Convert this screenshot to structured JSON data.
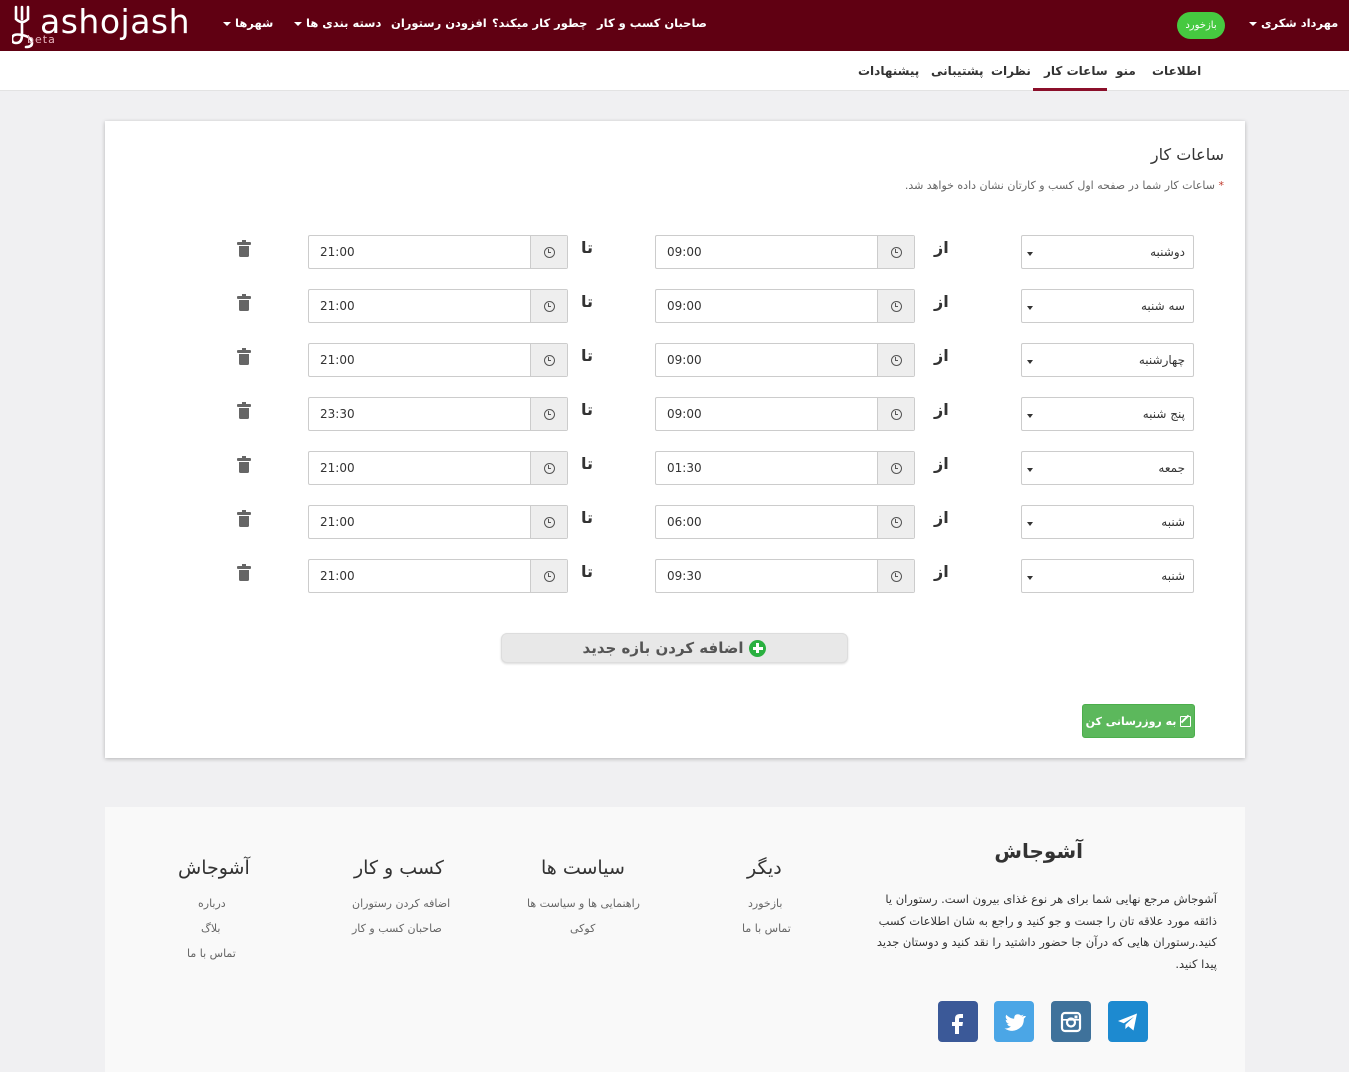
{
  "navbar": {
    "logo": "ashojash",
    "beta": "beta",
    "cities": "شهرها",
    "categories": "دسته بندی ها",
    "add_restaurant": "افزودن رستوران",
    "how_it_works": "چطور کار میکند؟",
    "business_owners": "صاحبان کسب و کار",
    "feedback": "بازخورد",
    "user_name": "مهرداد شکری"
  },
  "subnav": {
    "info": "اطلاعات",
    "menu": "منو",
    "hours": "ساعات کار",
    "reviews": "نظرات",
    "support": "پشتیبانی",
    "offers": "پیشنهادات"
  },
  "card": {
    "title": "ساعات کار",
    "note_star": "*",
    "note": " ساعات کار شما در صفحه اول کسب و کارتان نشان داده خواهد شد.",
    "from_label": "از",
    "to_label": "تا",
    "rows": [
      {
        "day": "دوشنبه",
        "from": "09:00",
        "to": "21:00"
      },
      {
        "day": "سه شنبه",
        "from": "09:00",
        "to": "21:00"
      },
      {
        "day": "چهارشنبه",
        "from": "09:00",
        "to": "21:00"
      },
      {
        "day": "پنج شنبه",
        "from": "09:00",
        "to": "23:30"
      },
      {
        "day": "جمعه",
        "from": "01:30",
        "to": "21:00"
      },
      {
        "day": "شنبه",
        "from": "06:00",
        "to": "21:00"
      },
      {
        "day": "شنبه",
        "from": "09:30",
        "to": "21:00"
      }
    ],
    "add_interval": "اضافه کردن بازه جدید",
    "update": "به روزرسانی کن"
  },
  "footer": {
    "about_title": "آشوجاش",
    "about_text": "آشوجاش مرجع نهایی شما برای هر نوع غذای بیرون است. رستوران یا ذائقه مورد علاقه تان را جست و جو کنید و راجع به شان اطلاعات کسب کنید.رستوران هایی که درآن جا حضور داشتید را نقد کنید و دوستان جدید پیدا کنید.",
    "col_other": {
      "title": "دیگر",
      "links": [
        "بازخورد",
        "تماس با ما"
      ]
    },
    "col_policies": {
      "title": "سیاست ها",
      "links": [
        "راهنمایی ها و سیاست ها",
        "کوکی"
      ]
    },
    "col_business": {
      "title": "کسب و کار",
      "links": [
        "اضافه کردن رستوران",
        "صاحبان کسب و کار"
      ]
    },
    "col_ashojash": {
      "title": "آشوجاش",
      "links": [
        "درباره",
        "بلاگ",
        "تماس با ما"
      ]
    }
  },
  "colors": {
    "navbar": "#600012",
    "accent": "#8b0f2a",
    "success": "#5cb85c"
  },
  "icons": [
    "fork-icon",
    "caret-down-icon",
    "clock-icon",
    "trash-icon",
    "plus-circle-icon",
    "edit-icon",
    "facebook-icon",
    "twitter-icon",
    "instagram-icon",
    "telegram-icon"
  ]
}
